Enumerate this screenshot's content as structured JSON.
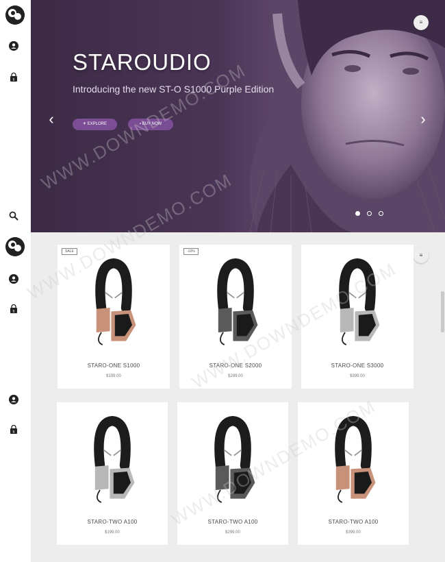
{
  "hero": {
    "title": "STAROUDIO",
    "subtitle": "Introducing the new ST-O S1000 Purple Edition",
    "explore_label": "EXPLORE",
    "buy_label": "BUY NOW",
    "prev_icon": "‹",
    "next_icon": "›",
    "slide_count": 3,
    "active_slide": 1
  },
  "menu_icon": "≡",
  "products_row1": [
    {
      "badge": "SALE",
      "name": "STARO-ONE S1000",
      "price": "$199.00",
      "color": "rose"
    },
    {
      "badge": "-10%",
      "name": "STARO-ONE S2000",
      "price": "$299.00",
      "color": "gunmetal"
    },
    {
      "badge": "",
      "name": "STARO-ONE S3000",
      "price": "$399.00",
      "color": "silver"
    }
  ],
  "products_row2": [
    {
      "badge": "",
      "name": "STARO-TWO A100",
      "price": "$199.00",
      "color": "silver"
    },
    {
      "badge": "",
      "name": "STARO-TWO A100",
      "price": "$299.00",
      "color": "gunmetal"
    },
    {
      "badge": "",
      "name": "STARO-TWO A100",
      "price": "$399.00",
      "color": "rose"
    }
  ],
  "watermark": "WWW.DOWNDEMO.COM",
  "colors": {
    "accent": "#7b4d95",
    "hero_bg": "#4b3556",
    "rose": "#c8917a",
    "gunmetal": "#5a5a5a",
    "silver": "#b8b8b8"
  }
}
